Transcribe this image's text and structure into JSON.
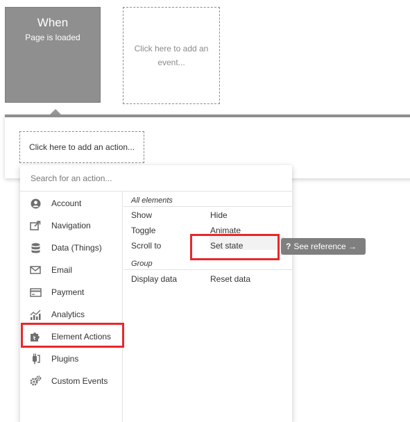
{
  "event": {
    "title": "When",
    "subtitle": "Page is loaded",
    "add_event_label": "Click here to add an event..."
  },
  "action": {
    "add_action_label": "Click here to add an action..."
  },
  "search": {
    "placeholder": "Search for an action..."
  },
  "categories": [
    {
      "label": "Account",
      "icon": "account-icon"
    },
    {
      "label": "Navigation",
      "icon": "navigation-icon"
    },
    {
      "label": "Data (Things)",
      "icon": "database-icon"
    },
    {
      "label": "Email",
      "icon": "email-icon"
    },
    {
      "label": "Payment",
      "icon": "payment-icon"
    },
    {
      "label": "Analytics",
      "icon": "analytics-icon"
    },
    {
      "label": "Element Actions",
      "icon": "puzzle-icon"
    },
    {
      "label": "Plugins",
      "icon": "plugins-icon"
    },
    {
      "label": "Custom Events",
      "icon": "gears-icon"
    }
  ],
  "sections": {
    "all_elements": {
      "title": "All elements",
      "actions": [
        "Show",
        "Hide",
        "Toggle",
        "Animate",
        "Scroll to",
        "Set state"
      ]
    },
    "group": {
      "title": "Group",
      "actions": [
        "Display data",
        "Reset data"
      ]
    }
  },
  "tooltip": {
    "icon": "question-icon",
    "label": "See reference →"
  },
  "colors": {
    "highlight_box": "#e8272b",
    "event_block": "#8f8f8f",
    "tooltip_bg": "#7f7f7f"
  }
}
